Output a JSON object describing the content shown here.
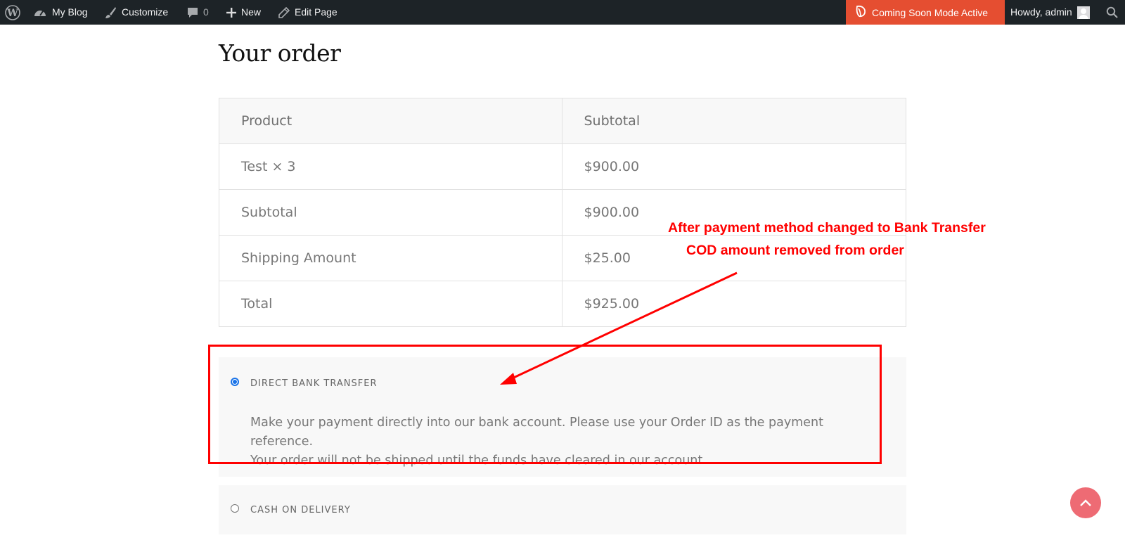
{
  "admin_bar": {
    "site_name": "My Blog",
    "customize_label": "Customize",
    "comments_count": "0",
    "new_label": "New",
    "edit_page_label": "Edit Page",
    "coming_soon_label": "Coming Soon Mode Active",
    "greeting": "Howdy, admin",
    "coming_soon_color": "#e54e31"
  },
  "page": {
    "title": "Your order"
  },
  "order_table": {
    "headers": [
      "Product",
      "Subtotal"
    ],
    "rows": [
      {
        "label": "Test  × 3",
        "value": "$900.00"
      },
      {
        "label": "Subtotal",
        "value": "$900.00"
      },
      {
        "label": "Shipping Amount",
        "value": "$25.00"
      },
      {
        "label": "Total",
        "value": "$925.00"
      }
    ]
  },
  "payment_methods": {
    "bank_transfer": {
      "label": "Direct bank transfer",
      "selected": true,
      "description_line1": "Make your payment directly into our bank account. Please use your Order ID as the payment reference.",
      "description_line2": "Your order will not be shipped until the funds have cleared in our account."
    },
    "cod": {
      "label": "Cash on delivery",
      "selected": false
    }
  },
  "annotation": {
    "line1": "After payment method changed to Bank Transfer",
    "line2": "COD amount removed from order",
    "color": "#ff0000"
  },
  "icons": {
    "wordpress": "wordpress-icon",
    "dashboard": "dashboard-icon",
    "customize": "brush-icon",
    "comments": "comment-icon",
    "new": "plus-icon",
    "edit": "pencil-icon",
    "coming_soon": "seedprod-leaf-icon",
    "search": "search-icon",
    "scroll_top": "chevron-up-icon"
  }
}
